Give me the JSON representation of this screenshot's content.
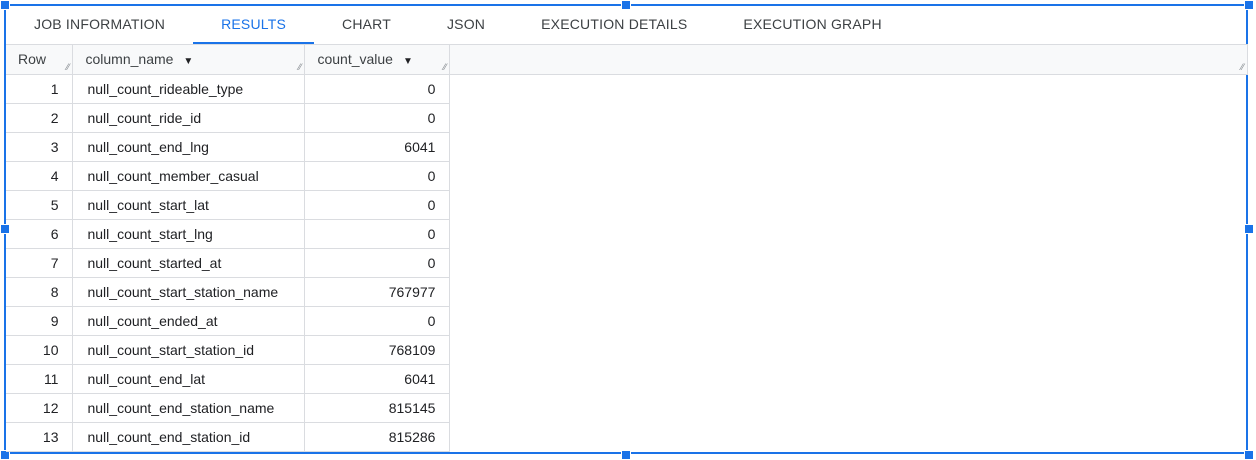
{
  "tabs": [
    {
      "label": "JOB INFORMATION",
      "active": false
    },
    {
      "label": "RESULTS",
      "active": true
    },
    {
      "label": "CHART",
      "active": false
    },
    {
      "label": "JSON",
      "active": false
    },
    {
      "label": "EXECUTION DETAILS",
      "active": false
    },
    {
      "label": "EXECUTION GRAPH",
      "active": false
    }
  ],
  "table": {
    "headers": {
      "row": "Row",
      "column_name": "column_name",
      "count_value": "count_value"
    },
    "rows": [
      {
        "row": "1",
        "column_name": "null_count_rideable_type",
        "count_value": "0"
      },
      {
        "row": "2",
        "column_name": "null_count_ride_id",
        "count_value": "0"
      },
      {
        "row": "3",
        "column_name": "null_count_end_lng",
        "count_value": "6041"
      },
      {
        "row": "4",
        "column_name": "null_count_member_casual",
        "count_value": "0"
      },
      {
        "row": "5",
        "column_name": "null_count_start_lat",
        "count_value": "0"
      },
      {
        "row": "6",
        "column_name": "null_count_start_lng",
        "count_value": "0"
      },
      {
        "row": "7",
        "column_name": "null_count_started_at",
        "count_value": "0"
      },
      {
        "row": "8",
        "column_name": "null_count_start_station_name",
        "count_value": "767977"
      },
      {
        "row": "9",
        "column_name": "null_count_ended_at",
        "count_value": "0"
      },
      {
        "row": "10",
        "column_name": "null_count_start_station_id",
        "count_value": "768109"
      },
      {
        "row": "11",
        "column_name": "null_count_end_lat",
        "count_value": "6041"
      },
      {
        "row": "12",
        "column_name": "null_count_end_station_name",
        "count_value": "815145"
      },
      {
        "row": "13",
        "column_name": "null_count_end_station_id",
        "count_value": "815286"
      }
    ]
  },
  "colors": {
    "accent": "#1a73e8",
    "header_bg": "#f8f9fa",
    "border": "#dadce0"
  },
  "icons": {
    "sort": "sort-dropdown-icon",
    "resize": "column-resize-icon"
  }
}
